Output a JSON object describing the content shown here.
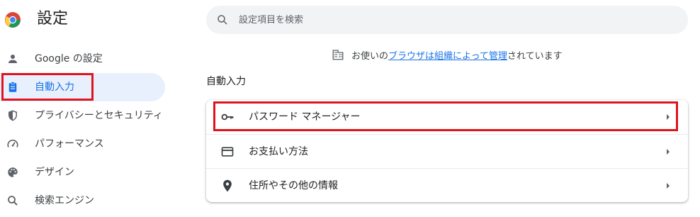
{
  "header": {
    "title": "設定",
    "search_placeholder": "設定項目を検索"
  },
  "sidebar": {
    "items": [
      {
        "label": "Google の設定",
        "icon": "person-icon"
      },
      {
        "label": "自動入力",
        "icon": "clipboard-icon",
        "active": true
      },
      {
        "label": "プライバシーとセキュリティ",
        "icon": "shield-icon"
      },
      {
        "label": "パフォーマンス",
        "icon": "speedometer-icon"
      },
      {
        "label": "デザイン",
        "icon": "palette-icon"
      },
      {
        "label": "検索エンジン",
        "icon": "search-icon"
      }
    ]
  },
  "managed_notice": {
    "prefix": "お使いの",
    "link1": "ブラウザは組織によって管理",
    "suffix": "されています"
  },
  "section": {
    "title": "自動入力",
    "rows": [
      {
        "label": "パスワード マネージャー",
        "icon": "key-icon"
      },
      {
        "label": "お支払い方法",
        "icon": "credit-card-icon"
      },
      {
        "label": "住所やその他の情報",
        "icon": "location-pin-icon"
      }
    ]
  },
  "colors": {
    "accent": "#1a73e8",
    "active_bg": "#e8f0fe",
    "highlight": "#e0141e"
  }
}
